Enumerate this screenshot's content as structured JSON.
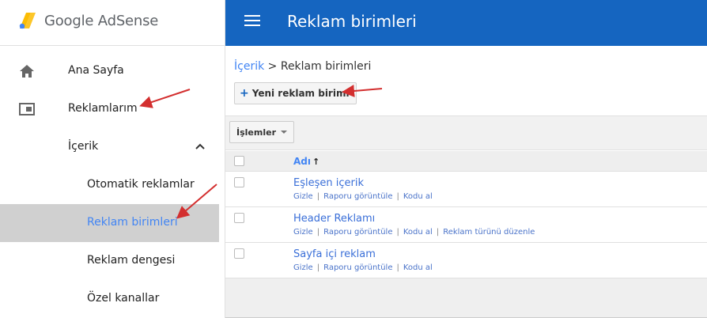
{
  "app": {
    "logo_text": "Google AdSense"
  },
  "sidebar": {
    "items": [
      {
        "label": "Ana Sayfa"
      },
      {
        "label": "Reklamlarım"
      },
      {
        "label": "İçerik"
      },
      {
        "label": "Otomatik reklamlar"
      },
      {
        "label": "Reklam birimleri"
      },
      {
        "label": "Reklam dengesi"
      },
      {
        "label": "Özel kanallar"
      }
    ]
  },
  "header": {
    "title": "Reklam birimleri"
  },
  "main": {
    "breadcrumb": {
      "link": "İçerik",
      "separator": " > ",
      "current": "Reklam birimleri"
    },
    "new_button": "Yeni reklam birimi",
    "actions_button": "İşlemler",
    "table": {
      "column_name": "Adı",
      "rows": [
        {
          "name": "Eşleşen içerik",
          "links": [
            "Gizle",
            "Raporu görüntüle",
            "Kodu al"
          ]
        },
        {
          "name": "Header Reklamı",
          "links": [
            "Gizle",
            "Raporu görüntüle",
            "Kodu al",
            "Reklam türünü düzenle"
          ]
        },
        {
          "name": "Sayfa içi reklam",
          "links": [
            "Gizle",
            "Raporu görüntüle",
            "Kodu al"
          ]
        }
      ]
    }
  },
  "colors": {
    "header_bg": "#1565c0",
    "link_blue": "#4285f4",
    "active_item_bg": "#d0d0d0",
    "annotation_arrow": "#d32f2f"
  }
}
